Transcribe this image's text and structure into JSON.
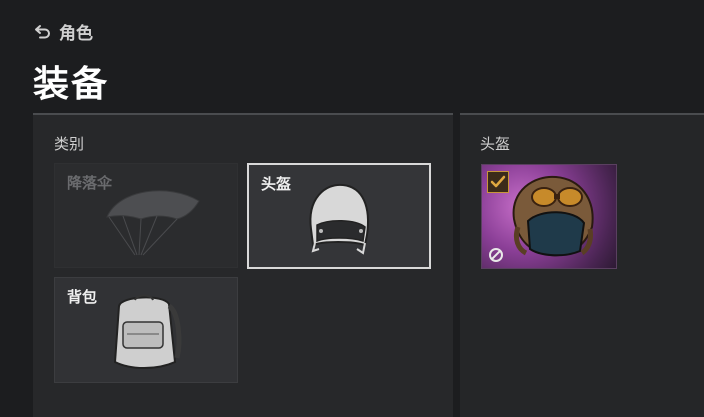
{
  "nav": {
    "back_label": "角色"
  },
  "page": {
    "title": "装备"
  },
  "categories": {
    "label": "类别",
    "items": [
      {
        "label": "降落伞",
        "icon": "parachute-icon",
        "state": "disabled"
      },
      {
        "label": "头盔",
        "icon": "helmet-icon",
        "state": "selected"
      },
      {
        "label": "背包",
        "icon": "backpack-icon",
        "state": "normal"
      }
    ]
  },
  "items_panel": {
    "label": "头盔",
    "items": [
      {
        "icon": "aviator-helmet-icon",
        "equipped": true,
        "badge_icon": "checkmark-icon",
        "status_icon": "ban-icon"
      }
    ]
  },
  "colors": {
    "accent": "#c8963a",
    "rarity_purple": "#8b3f97",
    "selected_border": "#d9d9d9"
  }
}
